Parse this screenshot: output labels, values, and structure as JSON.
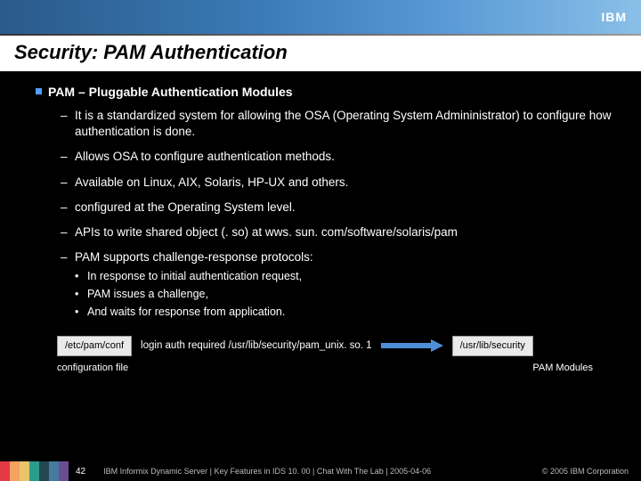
{
  "header": {
    "logo_text": "IBM"
  },
  "title": "Security: PAM Authentication",
  "main_bullet": "PAM – Pluggable Authentication Modules",
  "dashes": {
    "d0": "It is a standardized system for allowing the OSA (Operating System Admininistrator) to configure how authentication is done.",
    "d1": "Allows OSA to configure authentication methods.",
    "d2": "Available on Linux, AIX, Solaris, HP-UX and others.",
    "d3": "configured at the Operating System level.",
    "d4": "APIs to write shared object (. so) at wws. sun. com/software/solaris/pam",
    "d5": "PAM supports challenge-response protocols:"
  },
  "dots": {
    "s0": "In response to initial authentication request,",
    "s1": "PAM issues a challenge,",
    "s2": "And waits for response from application."
  },
  "diagram": {
    "box_left": "/etc/pam/conf",
    "config_line": "login auth required /usr/lib/security/pam_unix. so. 1",
    "box_right": "/usr/lib/security",
    "label_left": "configuration file",
    "label_right": "PAM Modules"
  },
  "footer": {
    "slide_num": "42",
    "text": "IBM Informix Dynamic Server | Key Features in IDS 10. 00  |  Chat With The Lab  |  2005-04-06",
    "copyright": "© 2005 IBM Corporation"
  }
}
